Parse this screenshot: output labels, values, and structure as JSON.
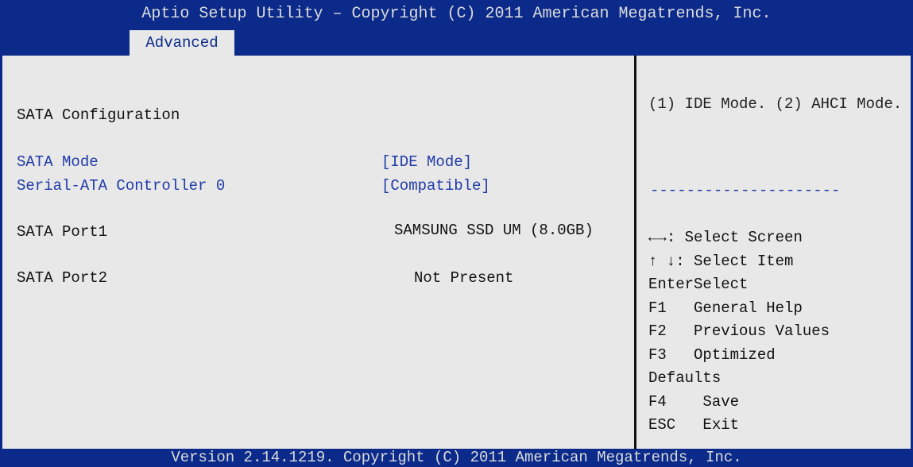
{
  "header": {
    "title": "Aptio Setup Utility – Copyright (C) 2011 American Megatrends, Inc.",
    "active_tab": "Advanced"
  },
  "main": {
    "section_title": "SATA Configuration",
    "settings": [
      {
        "label": "SATA Mode",
        "value": "[IDE Mode]"
      },
      {
        "label": "Serial-ATA Controller 0",
        "value": "[Compatible]"
      }
    ],
    "ports": [
      {
        "label": "SATA Port1",
        "value": "SAMSUNG SSD UM (8.0GB)"
      },
      {
        "label": "SATA Port2",
        "value": "Not Present"
      }
    ]
  },
  "help_panel": {
    "description": "(1) IDE Mode. (2) AHCI Mode.",
    "separator": "---------------------",
    "keys": [
      {
        "key": "←→",
        "desc": ": Select Screen"
      },
      {
        "key": "↑ ↓",
        "desc": ": Select Item"
      },
      {
        "key": "Enter",
        "desc": "Select"
      },
      {
        "key": "F1",
        "desc": "   General Help"
      },
      {
        "key": "F2",
        "desc": "   Previous Values"
      },
      {
        "key": "F3",
        "desc": "   Optimized"
      },
      {
        "key": "",
        "desc": "Defaults"
      },
      {
        "key": "F4",
        "desc": "    Save"
      },
      {
        "key": "ESC",
        "desc": "   Exit"
      }
    ]
  },
  "footer": {
    "version": "Version 2.14.1219. Copyright (C) 2011 American Megatrends, Inc."
  },
  "colors": {
    "bar_blue": "#0b2a8a",
    "background": "#e8e8e8",
    "setting_blue": "#1f3aa8"
  }
}
